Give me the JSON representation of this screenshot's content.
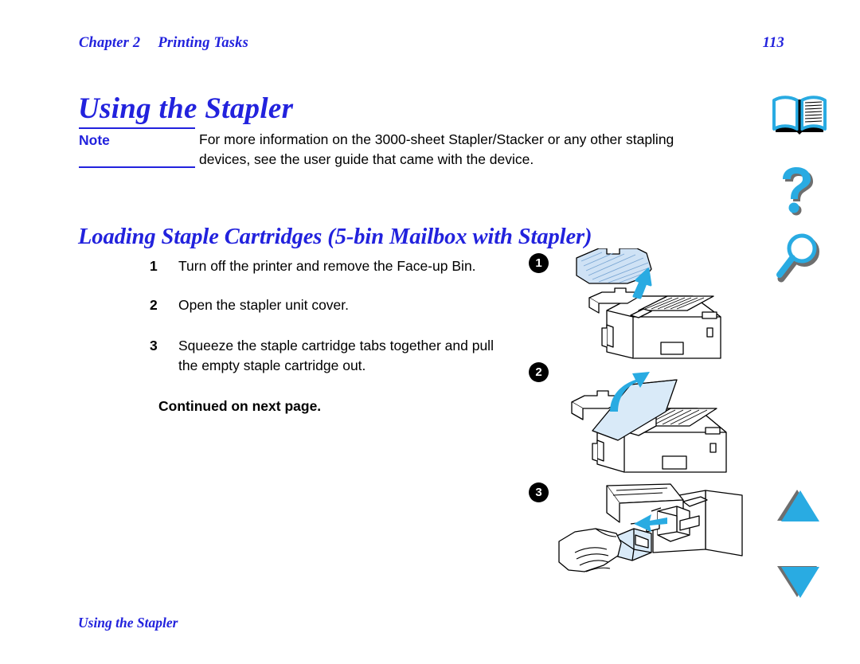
{
  "header": {
    "chapter": "Chapter 2",
    "section": "Printing Tasks",
    "page_number": "113"
  },
  "page_title": "Using the Stapler",
  "note": {
    "label": "Note",
    "text": "For more information on the 3000-sheet Stapler/Stacker or any other stapling devices, see the user guide that came with the device.",
    "rule_color": "#2222dd"
  },
  "section_title": "Loading Staple Cartridges (5-bin Mailbox with Stapler)",
  "steps": [
    {
      "number": "1",
      "text": "Turn off the printer and remove the Face-up Bin."
    },
    {
      "number": "2",
      "text": "Open the stapler unit cover."
    },
    {
      "number": "3",
      "text": "Squeeze the staple cartridge tabs together and pull the empty staple cartridge out."
    }
  ],
  "continued_note": "Continued on next page.",
  "footer": "Using the Stapler",
  "nav_rail": {
    "items": [
      {
        "icon": "open-book-icon",
        "name": "table-of-contents"
      },
      {
        "icon": "question-mark-icon",
        "name": "help"
      },
      {
        "icon": "magnifier-icon",
        "name": "search"
      },
      {
        "icon": "triangle-up-icon",
        "name": "previous-page"
      },
      {
        "icon": "triangle-down-icon",
        "name": "next-page"
      }
    ],
    "accent_color": "#29ABE2",
    "shadow_color": "#6e6e6e"
  },
  "figures": [
    {
      "badge": "1",
      "caption_ref": "Turn off the printer and remove the Face-up Bin.",
      "arrow_color": "#29ABE2",
      "part_fill": "#cfe2f5"
    },
    {
      "badge": "2",
      "caption_ref": "Open the stapler unit cover.",
      "arrow_color": "#29ABE2",
      "part_fill": "#d9eaf8"
    },
    {
      "badge": "3",
      "caption_ref": "Squeeze the staple cartridge tabs together and pull the empty staple cartridge out.",
      "arrow_color": "#29ABE2",
      "part_fill": "#d9eaf8"
    }
  ],
  "colors": {
    "heading_blue": "#2222dd",
    "icon_cyan": "#29ABE2",
    "text_black": "#000000"
  }
}
